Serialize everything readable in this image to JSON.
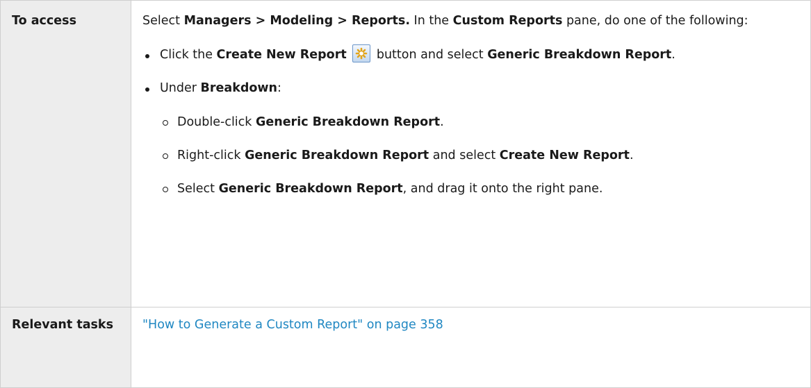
{
  "access": {
    "label": "To access",
    "intro": {
      "t1": "Select ",
      "b1": "Managers > Modeling > Reports.",
      "t2": " In the ",
      "b2": "Custom Reports",
      "t3": " pane, do one of the following:"
    },
    "bullet1": {
      "t1": "Click the ",
      "b1": "Create New Report",
      "icon": "create-new-report-icon",
      "t2": " button and select ",
      "b2": "Generic Breakdown Report",
      "t3": "."
    },
    "bullet2": {
      "t1": "Under ",
      "b1": "Breakdown",
      "t2": ":"
    },
    "sub1": {
      "t1": "Double-click ",
      "b1": "Generic Breakdown Report",
      "t2": "."
    },
    "sub2": {
      "t1": "Right-click ",
      "b1": "Generic Breakdown Report",
      "t2": " and select ",
      "b2": "Create New Report",
      "t3": "."
    },
    "sub3": {
      "t1": "Select ",
      "b1": "Generic Breakdown Report",
      "t2": ", and drag it onto the right pane."
    }
  },
  "tasks": {
    "label": "Relevant tasks",
    "link_text": "\"How to Generate a Custom Report\" on page 358"
  },
  "colors": {
    "link": "#1f87c2",
    "label_background": "#ededed",
    "border": "#cfcfcf"
  }
}
